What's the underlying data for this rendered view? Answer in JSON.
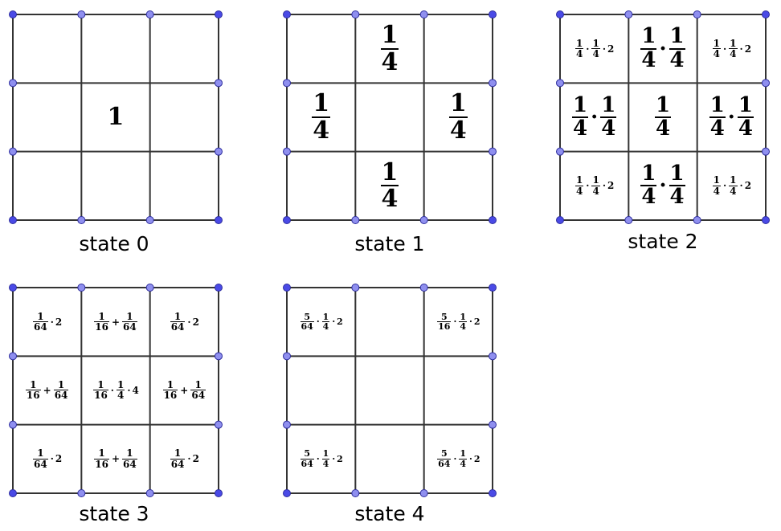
{
  "colors": {
    "grid_line": "#333333",
    "corner_vertex": "#4a4ae6",
    "edge_vertex": "#8f8fef",
    "vertex_stroke": "#2e2e9e"
  },
  "states": [
    {
      "caption": "state 0",
      "cells": [
        {
          "row": 1,
          "col": 1,
          "size": "big",
          "expr": [
            {
              "t": "text",
              "v": "1"
            }
          ]
        }
      ]
    },
    {
      "caption": "state 1",
      "cells": [
        {
          "row": 0,
          "col": 1,
          "size": "big",
          "expr": [
            {
              "t": "frac",
              "n": "1",
              "d": "4"
            }
          ]
        },
        {
          "row": 1,
          "col": 0,
          "size": "big",
          "expr": [
            {
              "t": "frac",
              "n": "1",
              "d": "4"
            }
          ]
        },
        {
          "row": 1,
          "col": 2,
          "size": "big",
          "expr": [
            {
              "t": "frac",
              "n": "1",
              "d": "4"
            }
          ]
        },
        {
          "row": 2,
          "col": 1,
          "size": "big",
          "expr": [
            {
              "t": "frac",
              "n": "1",
              "d": "4"
            }
          ]
        }
      ]
    },
    {
      "caption": "state 2",
      "cells": [
        {
          "row": 0,
          "col": 0,
          "size": "small",
          "expr": [
            {
              "t": "frac",
              "n": "1",
              "d": "4"
            },
            {
              "t": "op",
              "v": "·"
            },
            {
              "t": "frac",
              "n": "1",
              "d": "4"
            },
            {
              "t": "op",
              "v": "·"
            },
            {
              "t": "text",
              "v": "2"
            }
          ]
        },
        {
          "row": 0,
          "col": 1,
          "size": "med",
          "expr": [
            {
              "t": "frac",
              "n": "1",
              "d": "4"
            },
            {
              "t": "op",
              "v": "·"
            },
            {
              "t": "frac",
              "n": "1",
              "d": "4"
            }
          ]
        },
        {
          "row": 0,
          "col": 2,
          "size": "small",
          "expr": [
            {
              "t": "frac",
              "n": "1",
              "d": "4"
            },
            {
              "t": "op",
              "v": "·"
            },
            {
              "t": "frac",
              "n": "1",
              "d": "4"
            },
            {
              "t": "op",
              "v": "·"
            },
            {
              "t": "text",
              "v": "2"
            }
          ]
        },
        {
          "row": 1,
          "col": 0,
          "size": "med",
          "expr": [
            {
              "t": "frac",
              "n": "1",
              "d": "4"
            },
            {
              "t": "op",
              "v": "·"
            },
            {
              "t": "frac",
              "n": "1",
              "d": "4"
            }
          ]
        },
        {
          "row": 1,
          "col": 1,
          "size": "med",
          "expr": [
            {
              "t": "frac",
              "n": "1",
              "d": "4"
            }
          ]
        },
        {
          "row": 1,
          "col": 2,
          "size": "med",
          "expr": [
            {
              "t": "frac",
              "n": "1",
              "d": "4"
            },
            {
              "t": "op",
              "v": "·"
            },
            {
              "t": "frac",
              "n": "1",
              "d": "4"
            }
          ]
        },
        {
          "row": 2,
          "col": 0,
          "size": "small",
          "expr": [
            {
              "t": "frac",
              "n": "1",
              "d": "4"
            },
            {
              "t": "op",
              "v": "·"
            },
            {
              "t": "frac",
              "n": "1",
              "d": "4"
            },
            {
              "t": "op",
              "v": "·"
            },
            {
              "t": "text",
              "v": "2"
            }
          ]
        },
        {
          "row": 2,
          "col": 1,
          "size": "med",
          "expr": [
            {
              "t": "frac",
              "n": "1",
              "d": "4"
            },
            {
              "t": "op",
              "v": "·"
            },
            {
              "t": "frac",
              "n": "1",
              "d": "4"
            }
          ]
        },
        {
          "row": 2,
          "col": 2,
          "size": "small",
          "expr": [
            {
              "t": "frac",
              "n": "1",
              "d": "4"
            },
            {
              "t": "op",
              "v": "·"
            },
            {
              "t": "frac",
              "n": "1",
              "d": "4"
            },
            {
              "t": "op",
              "v": "·"
            },
            {
              "t": "text",
              "v": "2"
            }
          ]
        }
      ]
    },
    {
      "caption": "state 3",
      "cells": [
        {
          "row": 0,
          "col": 0,
          "size": "small",
          "expr": [
            {
              "t": "frac",
              "n": "1",
              "d": "64"
            },
            {
              "t": "op",
              "v": "·"
            },
            {
              "t": "text",
              "v": "2"
            }
          ]
        },
        {
          "row": 0,
          "col": 1,
          "size": "small",
          "expr": [
            {
              "t": "frac",
              "n": "1",
              "d": "16"
            },
            {
              "t": "op",
              "v": "+"
            },
            {
              "t": "frac",
              "n": "1",
              "d": "64"
            }
          ]
        },
        {
          "row": 0,
          "col": 2,
          "size": "small",
          "expr": [
            {
              "t": "frac",
              "n": "1",
              "d": "64"
            },
            {
              "t": "op",
              "v": "·"
            },
            {
              "t": "text",
              "v": "2"
            }
          ]
        },
        {
          "row": 1,
          "col": 0,
          "size": "small",
          "expr": [
            {
              "t": "frac",
              "n": "1",
              "d": "16"
            },
            {
              "t": "op",
              "v": "+"
            },
            {
              "t": "frac",
              "n": "1",
              "d": "64"
            }
          ]
        },
        {
          "row": 1,
          "col": 1,
          "size": "small",
          "expr": [
            {
              "t": "frac",
              "n": "1",
              "d": "16"
            },
            {
              "t": "op",
              "v": "·"
            },
            {
              "t": "frac",
              "n": "1",
              "d": "4"
            },
            {
              "t": "op",
              "v": "·"
            },
            {
              "t": "text",
              "v": "4"
            }
          ]
        },
        {
          "row": 1,
          "col": 2,
          "size": "small",
          "expr": [
            {
              "t": "frac",
              "n": "1",
              "d": "16"
            },
            {
              "t": "op",
              "v": "+"
            },
            {
              "t": "frac",
              "n": "1",
              "d": "64"
            }
          ]
        },
        {
          "row": 2,
          "col": 0,
          "size": "small",
          "expr": [
            {
              "t": "frac",
              "n": "1",
              "d": "64"
            },
            {
              "t": "op",
              "v": "·"
            },
            {
              "t": "text",
              "v": "2"
            }
          ]
        },
        {
          "row": 2,
          "col": 1,
          "size": "small",
          "expr": [
            {
              "t": "frac",
              "n": "1",
              "d": "16"
            },
            {
              "t": "op",
              "v": "+"
            },
            {
              "t": "frac",
              "n": "1",
              "d": "64"
            }
          ]
        },
        {
          "row": 2,
          "col": 2,
          "size": "small",
          "expr": [
            {
              "t": "frac",
              "n": "1",
              "d": "64"
            },
            {
              "t": "op",
              "v": "·"
            },
            {
              "t": "text",
              "v": "2"
            }
          ]
        }
      ]
    },
    {
      "caption": "state 4",
      "cells": [
        {
          "row": 0,
          "col": 0,
          "size": "tiny",
          "expr": [
            {
              "t": "frac",
              "n": "5",
              "d": "64"
            },
            {
              "t": "op",
              "v": "·"
            },
            {
              "t": "frac",
              "n": "1",
              "d": "4"
            },
            {
              "t": "op",
              "v": "·"
            },
            {
              "t": "text",
              "v": "2"
            }
          ]
        },
        {
          "row": 0,
          "col": 2,
          "size": "tiny",
          "expr": [
            {
              "t": "frac",
              "n": "5",
              "d": "16"
            },
            {
              "t": "op",
              "v": "·"
            },
            {
              "t": "frac",
              "n": "1",
              "d": "4"
            },
            {
              "t": "op",
              "v": "·"
            },
            {
              "t": "text",
              "v": "2"
            }
          ]
        },
        {
          "row": 2,
          "col": 0,
          "size": "tiny",
          "expr": [
            {
              "t": "frac",
              "n": "5",
              "d": "64"
            },
            {
              "t": "op",
              "v": "·"
            },
            {
              "t": "frac",
              "n": "1",
              "d": "4"
            },
            {
              "t": "op",
              "v": "·"
            },
            {
              "t": "text",
              "v": "2"
            }
          ]
        },
        {
          "row": 2,
          "col": 2,
          "size": "tiny",
          "expr": [
            {
              "t": "frac",
              "n": "5",
              "d": "64"
            },
            {
              "t": "op",
              "v": "·"
            },
            {
              "t": "frac",
              "n": "1",
              "d": "4"
            },
            {
              "t": "op",
              "v": "·"
            },
            {
              "t": "text",
              "v": "2"
            }
          ]
        }
      ]
    }
  ]
}
